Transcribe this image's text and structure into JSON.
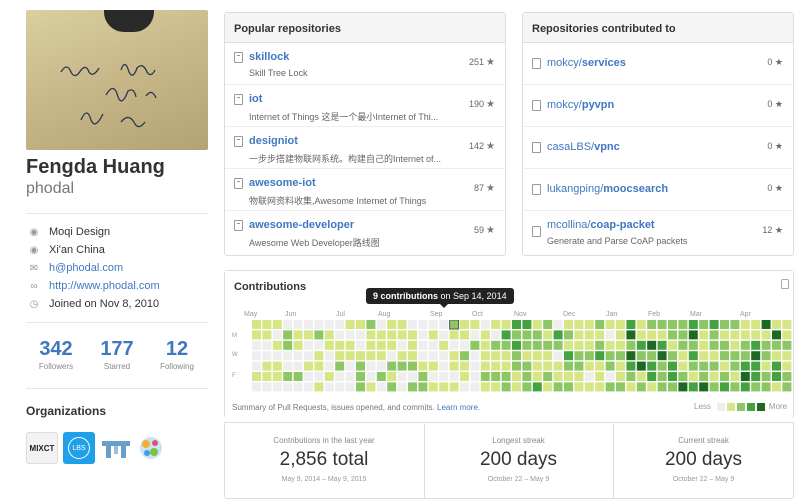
{
  "profile": {
    "full_name": "Fengda Huang",
    "username": "phodal",
    "company": "Moqi Design",
    "location": "Xi'an China",
    "email": "h@phodal.com",
    "website": "http://www.phodal.com",
    "joined": "Joined on Nov 8, 2010",
    "icons": [
      "org-icon",
      "location-icon",
      "mail-icon",
      "link-icon",
      "clock-icon"
    ]
  },
  "stats": {
    "followers": {
      "value": "342",
      "label": "Followers"
    },
    "starred": {
      "value": "177",
      "label": "Starred"
    },
    "following": {
      "value": "12",
      "label": "Following"
    }
  },
  "organizations": {
    "title": "Organizations",
    "items": [
      "MIXCT",
      "LBS",
      "",
      ""
    ]
  },
  "popular": {
    "title": "Popular repositories",
    "repos": [
      {
        "name": "skillock",
        "desc": "Skill Tree Lock",
        "stars": "251"
      },
      {
        "name": "iot",
        "desc": "Internet of Things 这是一个最小Internet of Thi...",
        "stars": "190"
      },
      {
        "name": "designiot",
        "desc": "一步步搭建物联网系统。构建自己的Internet of...",
        "stars": "142"
      },
      {
        "name": "awesome-iot",
        "desc": "物联网资料收集,Awesome Internet of Things",
        "stars": "87"
      },
      {
        "name": "awesome-developer",
        "desc": "Awesome Web Developer路线图",
        "stars": "59"
      }
    ]
  },
  "contributed": {
    "title": "Repositories contributed to",
    "repos": [
      {
        "owner": "mokcy/",
        "name": "services",
        "desc": "",
        "stars": "0"
      },
      {
        "owner": "mokcy/",
        "name": "pyvpn",
        "desc": "",
        "stars": "0"
      },
      {
        "owner": "casaLBS/",
        "name": "vpnc",
        "desc": "",
        "stars": "0"
      },
      {
        "owner": "lukangping/",
        "name": "moocsearch",
        "desc": "",
        "stars": "0"
      },
      {
        "owner": "mcollina/",
        "name": "coap-packet",
        "desc": "Generate and Parse CoAP packets",
        "stars": "12"
      }
    ]
  },
  "contributions": {
    "title": "Contributions",
    "tooltip_count": "9 contributions",
    "tooltip_date": "on Sep 14, 2014",
    "months": [
      "May",
      "Jun",
      "Jul",
      "Aug",
      "Sep",
      "Oct",
      "Nov",
      "Dec",
      "Jan",
      "Feb",
      "Mar",
      "Apr"
    ],
    "days": [
      "M",
      "W",
      "F"
    ],
    "summary_text": "Summary of Pull Requests, issues opened, and commits.",
    "learn_more": "Learn more.",
    "legend_less": "Less",
    "legend_more": "More",
    "colors": [
      "#eeeeee",
      "#d6e685",
      "#8cc665",
      "#44a340",
      "#1e6823"
    ],
    "last_year": {
      "title": "Contributions in the last year",
      "value": "2,856 total",
      "range": "May 9, 2014 – May 9, 2015"
    },
    "longest": {
      "title": "Longest streak",
      "value": "200 days",
      "range": "October 22 – May 9"
    },
    "current": {
      "title": "Current streak",
      "value": "200 days",
      "range": "October 22 – May 9"
    }
  }
}
